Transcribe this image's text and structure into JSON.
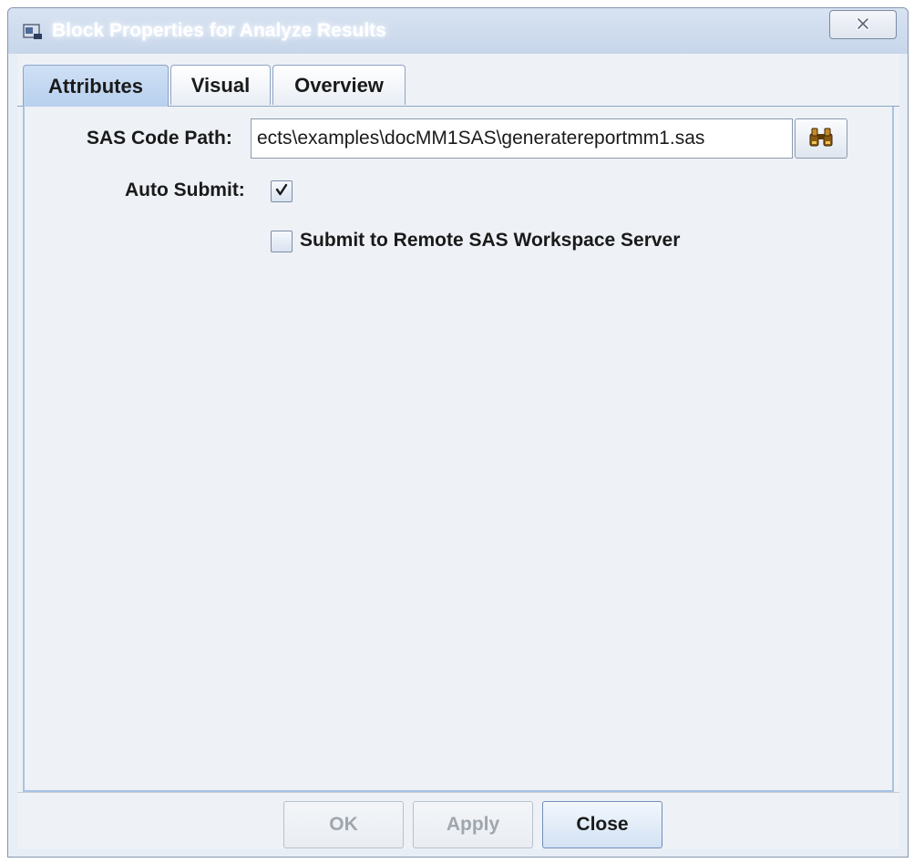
{
  "window": {
    "title": "Block Properties for Analyze Results",
    "close_glyph": "✕"
  },
  "tabs": [
    {
      "label": "Attributes",
      "active": true
    },
    {
      "label": "Visual",
      "active": false
    },
    {
      "label": "Overview",
      "active": false
    }
  ],
  "attributes": {
    "sas_code_path_label": "SAS Code Path:",
    "sas_code_path_value": "ects\\examples\\docMM1SAS\\generatereportmm1.sas",
    "auto_submit_label": "Auto Submit:",
    "auto_submit_checked": true,
    "remote_submit_label": "Submit to Remote SAS Workspace Server",
    "remote_submit_checked": false
  },
  "buttons": {
    "ok": "OK",
    "apply": "Apply",
    "close": "Close"
  },
  "icons": {
    "app": "app-window-icon",
    "browse": "binoculars-icon",
    "check": "checkmark-icon"
  },
  "colors": {
    "active_tab": "#b7d0ee",
    "panel_border": "#a9c3e6",
    "window_bg": "#e8eef6"
  }
}
